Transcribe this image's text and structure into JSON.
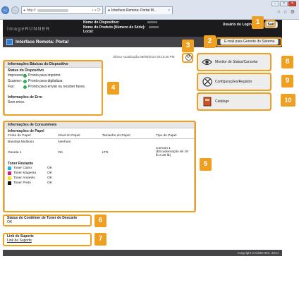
{
  "browser": {
    "address_prefix": "http://",
    "address_controls": "⌕ ▾ ⟳",
    "tab_label": "Interface Remota: Portal M...",
    "tab_close": "×",
    "window_buttons": [
      "–",
      "□",
      "×"
    ],
    "right_icons": [
      "⌂",
      "☆",
      "⚙"
    ]
  },
  "header": {
    "logo": "imageRUNNER",
    "device_name_label": "Nome do Dispositivo:",
    "product_name_label": "Nome do Produto (Número de Série):",
    "location_label": "Local:",
    "user_label": "Usuário do Login:",
    "logout_button": "Sair"
  },
  "titlebar": {
    "title": "Interface Remota: Portal",
    "email_button": "E-mail para Gerente do Sistema"
  },
  "last_update": "Última Atualização:09/09/2014 08:10:30 PM",
  "device_info": {
    "title": "Informações Básicas do Dispositivo",
    "status_title": "Status do Dispositivo",
    "rows": [
      {
        "label": "Impressora:",
        "value": "Pronto para imprimir."
      },
      {
        "label": "Scanner:",
        "value": "Pronto para digitalizar."
      },
      {
        "label": "Fax:",
        "value": "Pronto para enviar ou receber faxes."
      }
    ],
    "error_title": "Informações de Erro",
    "error_value": "Sem erros."
  },
  "consumables": {
    "title": "Informações de Consumíveis",
    "paper_title": "Informações de Papel",
    "columns": [
      "Fonte do Papel",
      "Nível do Papel",
      "Tamanho do Papel",
      "Tipo de Papel"
    ],
    "rows": [
      [
        "Bandeja Multiuso",
        "Nenhum",
        "",
        ""
      ],
      [
        "Gaveta 1",
        "OK",
        "LTR",
        "Comum 1 (Encadernação de 18 lb a 20 lb)"
      ]
    ],
    "toner_title": "Toner Restante",
    "toners": [
      {
        "name": "Toner Ciano",
        "level": "OK",
        "color": "#19b7e8"
      },
      {
        "name": "Toner Magenta",
        "level": "OK",
        "color": "#e0198c"
      },
      {
        "name": "Toner Amarelo",
        "level": "OK",
        "color": "#f5e21a"
      },
      {
        "name": "Toner Preto",
        "level": "OK",
        "color": "#111111"
      }
    ]
  },
  "waste_toner": {
    "title": "Status do Contêiner de Toner de Descarte",
    "value": "OK"
  },
  "support": {
    "title": "Link de Suporte",
    "link": "Link de Suporte"
  },
  "side_buttons": {
    "status_monitor": "Monitor de Status/Cancelar",
    "settings": "Configurações/Registro",
    "catalog": "Catálogo"
  },
  "badges": [
    "1",
    "2",
    "3",
    "4",
    "5",
    "6",
    "7",
    "8",
    "9",
    "10"
  ],
  "footer": "Copyright CANON INC. 2014",
  "colors": {
    "accent": "#f0a020",
    "header": "#1b1b1d",
    "titlebar": "#444448"
  }
}
